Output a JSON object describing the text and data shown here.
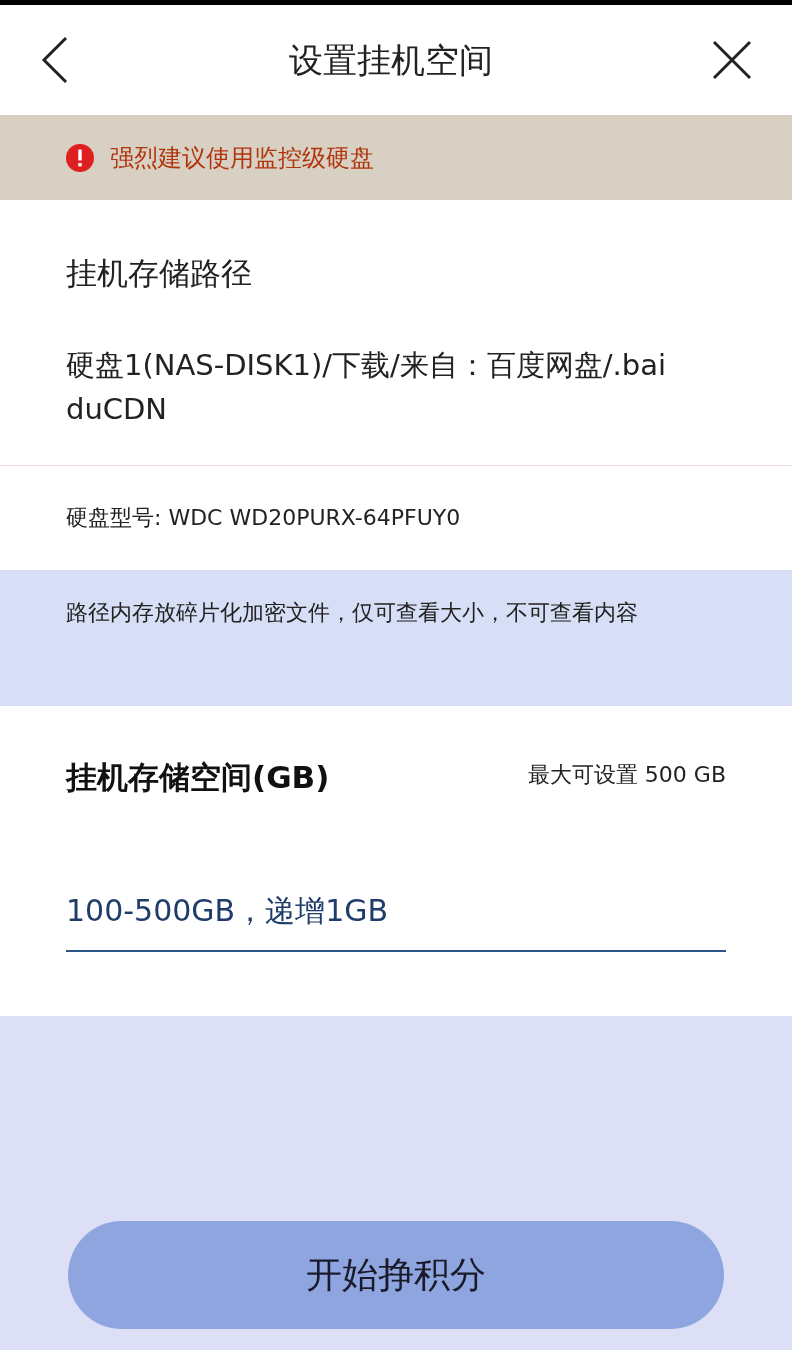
{
  "header": {
    "title": "设置挂机空间"
  },
  "warning": {
    "text": "强烈建议使用监控级硬盘"
  },
  "storage_path": {
    "label": "挂机存储路径",
    "value": "硬盘1(NAS-DISK1)/下载/来自：百度网盘/.baiduCDN"
  },
  "disk_model": "硬盘型号: WDC WD20PURX-64PFUY0",
  "notice": "路径内存放碎片化加密文件，仅可查看大小，不可查看内容",
  "storage_space": {
    "label": "挂机存储空间(GB)",
    "max": "最大可设置 500 GB",
    "placeholder": "100-500GB，递增1GB"
  },
  "button": "开始挣积分"
}
